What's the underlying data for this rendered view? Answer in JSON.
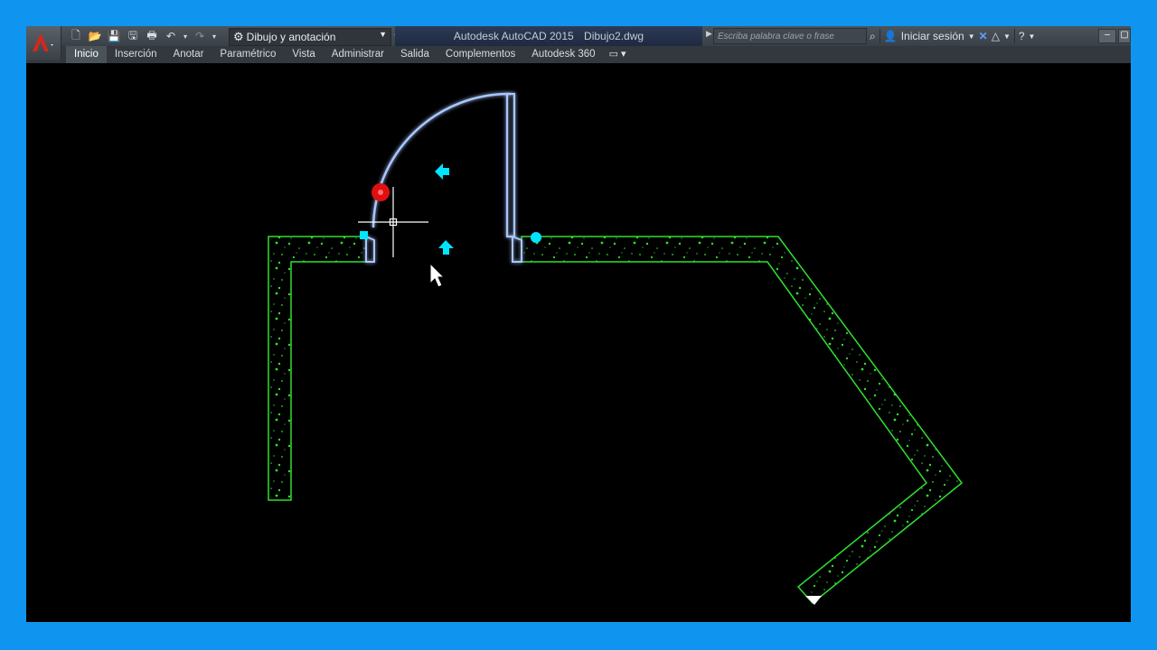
{
  "app": {
    "name": "Autodesk AutoCAD 2015",
    "document": "Dibujo2.dwg"
  },
  "workspace": {
    "label": "Dibujo y anotación"
  },
  "search": {
    "placeholder": "Escriba palabra clave o frase"
  },
  "account": {
    "signin_label": "Iniciar sesión"
  },
  "menu": {
    "tabs": [
      {
        "label": "Inicio",
        "active": true
      },
      {
        "label": "Inserción"
      },
      {
        "label": "Anotar"
      },
      {
        "label": "Paramétrico"
      },
      {
        "label": "Vista"
      },
      {
        "label": "Administrar"
      },
      {
        "label": "Salida"
      },
      {
        "label": "Complementos"
      },
      {
        "label": "Autodesk 360"
      }
    ]
  },
  "icons": {
    "qat": [
      "new-icon",
      "open-icon",
      "save-icon",
      "save-as-icon",
      "print-icon",
      "undo-icon",
      "redo-icon"
    ],
    "right": [
      "binoculars-icon",
      "user-icon",
      "exchange-icon",
      "a360-icon",
      "help-icon"
    ]
  },
  "colors": {
    "wall": "#2fe02f",
    "door": "#a9c6ff",
    "grip": "#00e5ff",
    "grip_hot": "#e01010",
    "crosshair": "#ffffff"
  }
}
